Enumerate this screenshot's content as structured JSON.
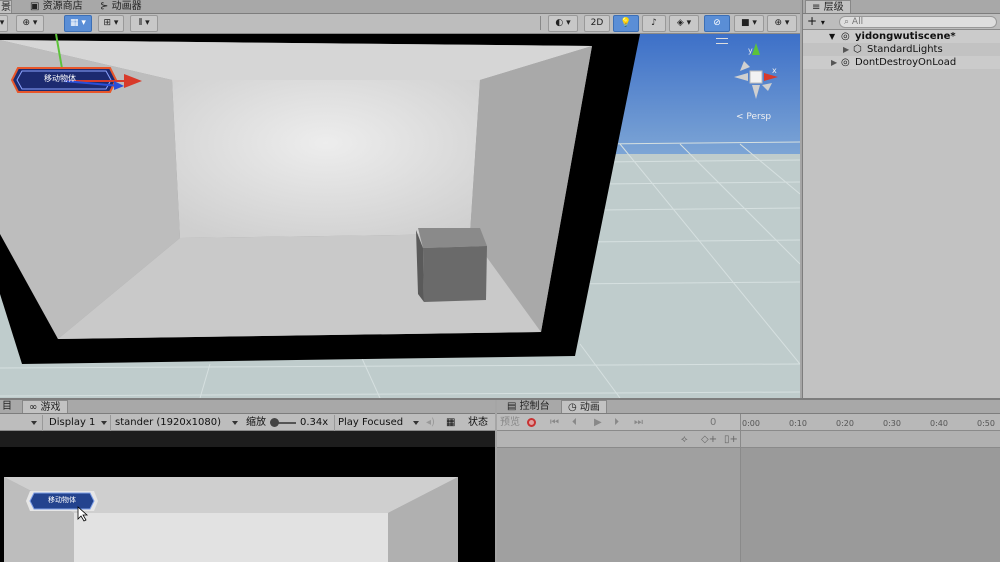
{
  "top_tabs": {
    "scene_tab_partial": "景",
    "asset_store": "资源商店",
    "animator": "动画器"
  },
  "scene_toolbar": {
    "mode_2d": "2D"
  },
  "scene_view": {
    "button_label": "移动物体",
    "persp_label": "< Persp"
  },
  "hierarchy": {
    "tab_label": "层级",
    "add_label": "+",
    "search_placeholder": "All",
    "scene_name": "yidongwutiscene*",
    "items": [
      {
        "label": "StandardLights"
      },
      {
        "label": "DontDestroyOnLoad"
      }
    ]
  },
  "game_panel": {
    "tab_partial": "目",
    "tab_label": "游戏",
    "display": "Display 1",
    "resolution": "stander (1920x1080)",
    "scale_label": "缩放",
    "scale_value": "0.34x",
    "play_mode": "Play Focused",
    "stats_label": "状态",
    "button_label": "移动物体"
  },
  "console_tab": "控制台",
  "animation": {
    "tab_label": "动画",
    "preview_label": "预览",
    "frame_value": "0",
    "timeline_ticks": [
      "0:00",
      "0:10",
      "0:20",
      "0:30",
      "0:40",
      "0:50"
    ]
  },
  "colors": {
    "accent_blue": "#5a8ed6",
    "record_red": "#c83232",
    "gizmo_red": "#d83a2a",
    "gizmo_green": "#5cc23a",
    "gizmo_blue": "#2a4fd8"
  }
}
